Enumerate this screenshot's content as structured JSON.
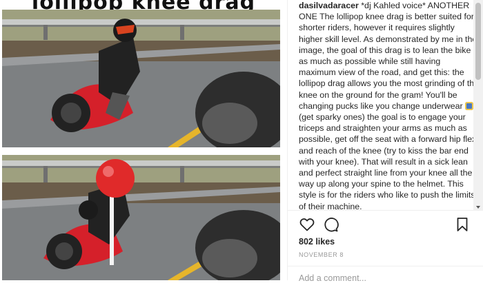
{
  "post": {
    "banner_text": "lollipop knee drag",
    "username": "dasilvadaracer",
    "caption_before_emoji": " *dj Kahled voice* ANOTHER ONE The lollipop knee drag is better suited for shorter riders, however it requires slightly higher skill level. As demonstrated by me in the image, the goal of this drag is to lean the bike as much as possible while still having maximum view of the road, and get this: the lollipop drag allows you the most grinding of the knee on the ground for the gram! You'll be changing pucks like you change underwear ",
    "caption_emoji_icon": "briefs-emoji-icon",
    "caption_after_emoji": " (get sparky ones) the goal is to engage your triceps and straighten your arms as much as possible, get off the seat with a forward hip flex and reach of the knee (try to kiss the bar end with your knee). That will result in a sick lean and perfect straight line from your knee all the way up along your spine to the helmet. This style is for the riders who like to push the limits of their machine.",
    "likes": "802 likes",
    "date": "November 8",
    "comment_placeholder": "Add a comment..."
  },
  "icons": {
    "like": "heart-icon",
    "comment": "comment-bubble-icon",
    "save": "bookmark-icon"
  },
  "colors": {
    "text": "#262626",
    "muted": "#999999",
    "separator": "#efefef",
    "lollipop": "#e02a2a",
    "bike": "#d5202a"
  }
}
